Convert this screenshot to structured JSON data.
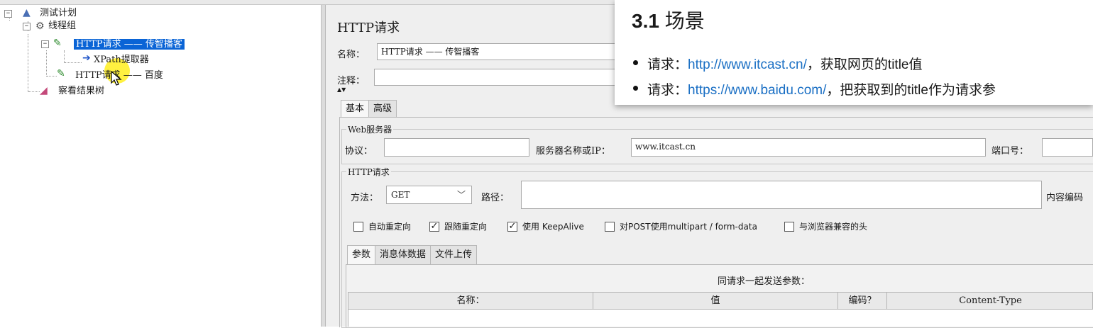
{
  "tree": {
    "items": [
      {
        "label": "测试计划"
      },
      {
        "label": "线程组"
      },
      {
        "label": "HTTP请求 —— 传智播客"
      },
      {
        "label": "XPath提取器"
      },
      {
        "label": "HTTP请求 —— 百度"
      },
      {
        "label": "察看结果树"
      }
    ]
  },
  "panel": {
    "title": "HTTP请求",
    "name_label": "名称：",
    "name_value": "HTTP请求 —— 传智播客",
    "comment_label": "注释：",
    "tabs": [
      "基本",
      "高级"
    ],
    "web_server": {
      "title": "Web服务器",
      "protocol_label": "协议：",
      "protocol_value": "",
      "server_label": "服务器名称或IP：",
      "server_value": "www.itcast.cn",
      "port_label": "端口号："
    },
    "http_request": {
      "title": "HTTP请求",
      "method_label": "方法：",
      "method_value": "GET",
      "path_label": "路径：",
      "encoding_label": "内容编码"
    },
    "checkboxes": [
      {
        "label": "自动重定向",
        "checked": false
      },
      {
        "label": "跟随重定向",
        "checked": true
      },
      {
        "label": "使用 KeepAlive",
        "checked": true
      },
      {
        "label": "对POST使用multipart / form-data",
        "checked": false
      },
      {
        "label": "与浏览器兼容的头",
        "checked": false
      }
    ],
    "subtabs": [
      "参数",
      "消息体数据",
      "文件上传"
    ],
    "params_caption": "同请求一起发送参数：",
    "table_headers": [
      "名称：",
      "值",
      "编码？",
      "Content-Type"
    ]
  },
  "overlay": {
    "title_num": "3.1",
    "title_text": "场景",
    "item1_prefix": "请求：",
    "item1_link": "http://www.itcast.cn/",
    "item1_suffix": "，获取网页的title值",
    "item2_prefix": "请求：",
    "item2_link": "https://www.baidu.com/",
    "item2_suffix": "，把获取到的title作为请求参"
  }
}
